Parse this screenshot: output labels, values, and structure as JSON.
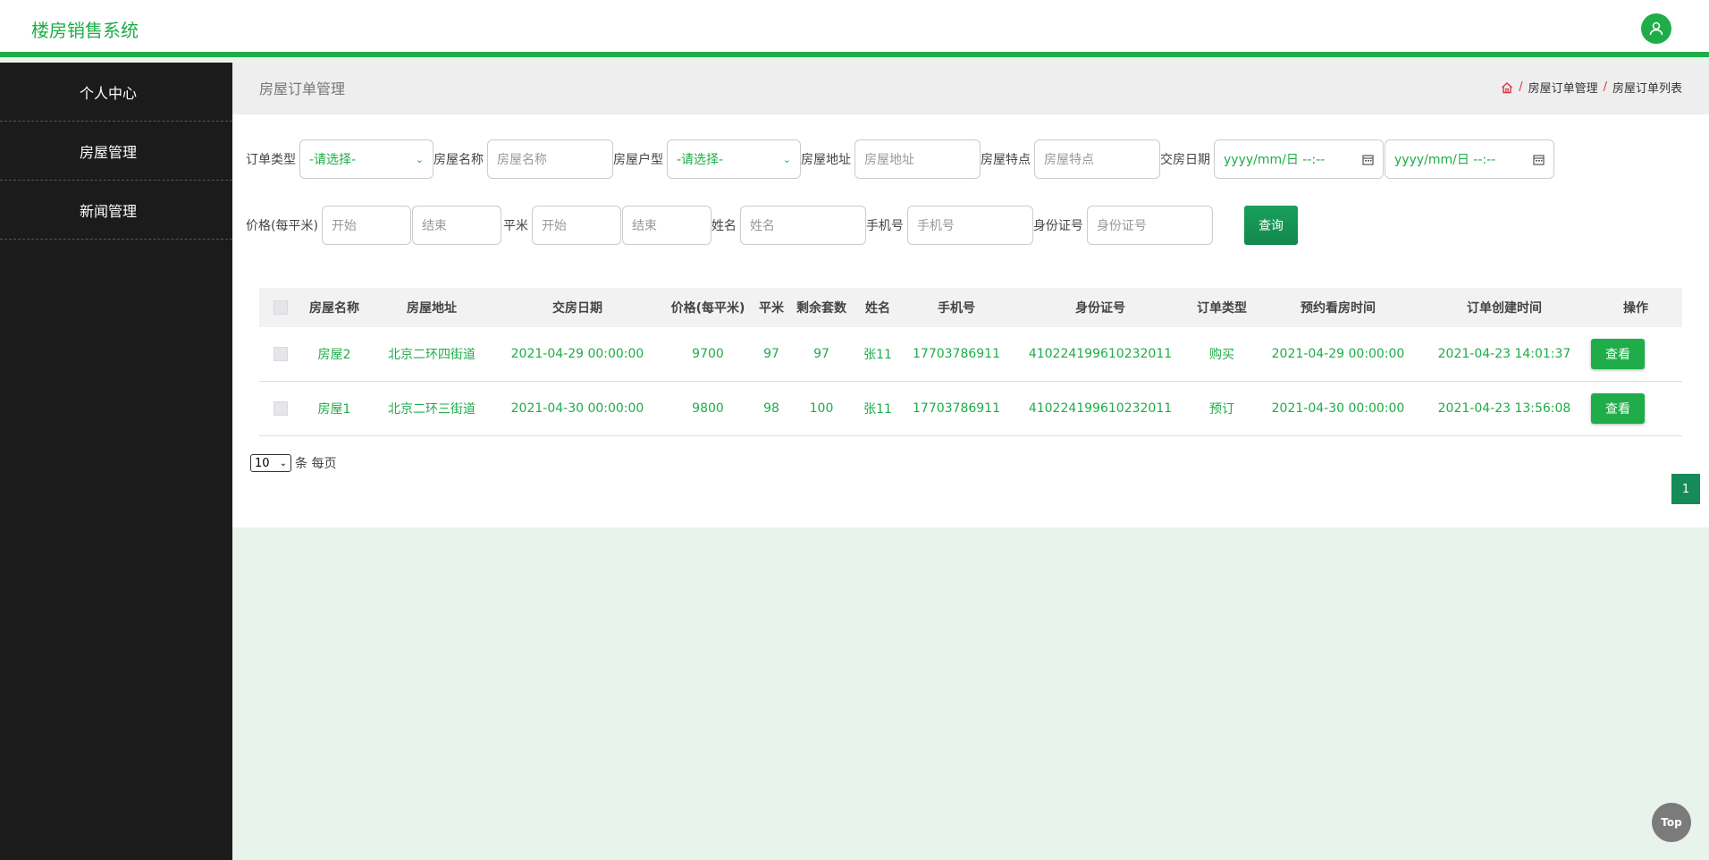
{
  "header": {
    "app_title": "楼房销售系统"
  },
  "sidebar": {
    "items": [
      {
        "label": "个人中心"
      },
      {
        "label": "房屋管理"
      },
      {
        "label": "新闻管理"
      }
    ]
  },
  "page": {
    "title": "房屋订单管理",
    "breadcrumb": [
      "房屋订单管理",
      "房屋订单列表"
    ],
    "breadcrumb_sep": "/"
  },
  "filters": {
    "order_type": {
      "label": "订单类型",
      "value": "-请选择-"
    },
    "house_name": {
      "label": "房屋名称",
      "placeholder": "房屋名称"
    },
    "house_type": {
      "label": "房屋户型",
      "value": "-请选择-"
    },
    "house_address": {
      "label": "房屋地址",
      "placeholder": "房屋地址"
    },
    "house_feature": {
      "label": "房屋特点",
      "placeholder": "房屋特点"
    },
    "handover_date": {
      "label": "交房日期",
      "from": "yyyy/mm/日 --:--",
      "to": "yyyy/mm/日 --:--"
    },
    "price": {
      "label": "价格(每平米)",
      "from_placeholder": "开始",
      "to_placeholder": "结束"
    },
    "area": {
      "label": "平米",
      "from_placeholder": "开始",
      "to_placeholder": "结束"
    },
    "name": {
      "label": "姓名",
      "placeholder": "姓名"
    },
    "phone": {
      "label": "手机号",
      "placeholder": "手机号"
    },
    "id_card": {
      "label": "身份证号",
      "placeholder": "身份证号"
    },
    "query_label": "查询"
  },
  "table": {
    "columns": [
      "房屋名称",
      "房屋地址",
      "交房日期",
      "价格(每平米)",
      "平米",
      "剩余套数",
      "姓名",
      "手机号",
      "身份证号",
      "订单类型",
      "预约看房时间",
      "订单创建时间",
      "操作"
    ],
    "rows": [
      {
        "cells": [
          "房屋2",
          "北京二环四街道",
          "2021-04-29 00:00:00",
          "9700",
          "97",
          "97",
          "张11",
          "17703786911",
          "410224199610232011",
          "购买",
          "2021-04-29 00:00:00",
          "2021-04-23 14:01:37"
        ],
        "action": "查看"
      },
      {
        "cells": [
          "房屋1",
          "北京二环三街道",
          "2021-04-30 00:00:00",
          "9800",
          "98",
          "100",
          "张11",
          "17703786911",
          "410224199610232011",
          "预订",
          "2021-04-30 00:00:00",
          "2021-04-23 13:56:08"
        ],
        "action": "查看"
      }
    ]
  },
  "pagination": {
    "page_size": "10",
    "page_size_label": "条 每页",
    "current_page": "1"
  },
  "top_button": "Top",
  "colors": {
    "accent": "#1ead48",
    "sidebar": "#1b1b1b",
    "breadcrumb_sep": "#d7373f"
  }
}
